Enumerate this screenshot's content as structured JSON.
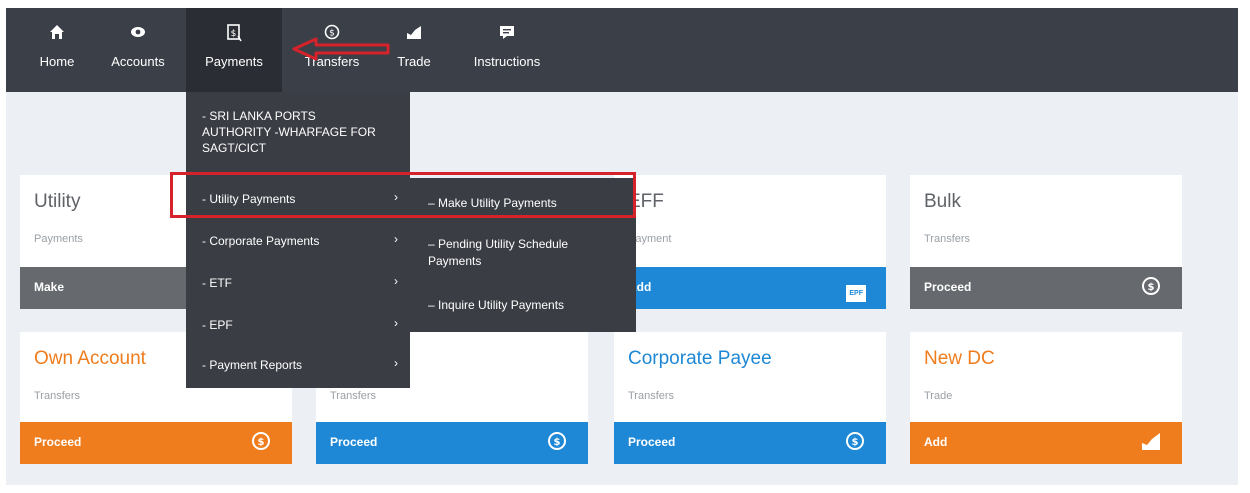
{
  "nav": {
    "items": [
      {
        "label": "Home",
        "icon": "home-icon"
      },
      {
        "label": "Accounts",
        "icon": "accounts-icon"
      },
      {
        "label": "Payments",
        "icon": "payments-icon"
      },
      {
        "label": "Transfers",
        "icon": "transfers-icon"
      },
      {
        "label": "Trade",
        "icon": "trade-icon"
      },
      {
        "label": "Instructions",
        "icon": "instructions-icon"
      }
    ],
    "active": "Payments"
  },
  "dropdown": {
    "top_item": "- SRI LANKA PORTS AUTHORITY -WHARFAGE FOR SAGT/CICT",
    "items": [
      {
        "label": "- Utility Payments",
        "chevron": "›"
      },
      {
        "label": "- Corporate Payments",
        "chevron": "›"
      },
      {
        "label": "- ETF",
        "chevron": "›"
      },
      {
        "label": "- EPF",
        "chevron": "›"
      },
      {
        "label": "- Payment Reports",
        "chevron": "›"
      }
    ]
  },
  "submenu": {
    "items": [
      "– Make Utility Payments",
      "– Pending Utility Schedule Payments",
      "– Inquire Utility Payments"
    ]
  },
  "cards": {
    "utility": {
      "title": "Utility",
      "sub": "Payments",
      "action": "Make"
    },
    "etf": {
      "title": "EFF",
      "sub": "Payment",
      "action": "Add",
      "icon_text": "EPF"
    },
    "bulk": {
      "title": "Bulk",
      "sub": "Transfers",
      "action": "Proceed"
    },
    "own": {
      "title": "Own Account",
      "sub": "Transfers",
      "action": "Proceed"
    },
    "second": {
      "sub": "Transfers",
      "action": "Proceed"
    },
    "corporate": {
      "title": "Corporate Payee",
      "sub": "Transfers",
      "action": "Proceed"
    },
    "newdc": {
      "title": "New DC",
      "sub": "Trade",
      "action": "Add"
    }
  },
  "colors": {
    "nav_bg": "#3b3f47",
    "menu_bg": "#3a3d44",
    "gray_bar": "#66696e",
    "blue_bar": "#1e88d6",
    "orange_bar": "#ef7d1e",
    "annotation_red": "#d6222a"
  }
}
